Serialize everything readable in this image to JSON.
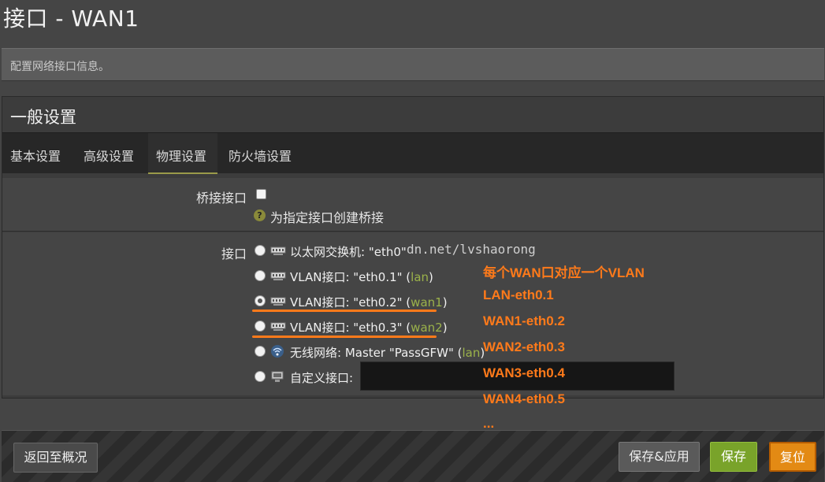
{
  "page": {
    "title": "接口 - WAN1",
    "description": "配置网络接口信息。"
  },
  "section": {
    "title": "一般设置"
  },
  "tabs": [
    {
      "label": "基本设置"
    },
    {
      "label": "高级设置"
    },
    {
      "label": "物理设置"
    },
    {
      "label": "防火墙设置"
    }
  ],
  "bridge": {
    "label": "桥接接口",
    "help": "为指定接口创建桥接",
    "checked": false
  },
  "iface": {
    "label": "接口",
    "options": [
      {
        "text": "以太网交换机: \"eth0\"",
        "net": "",
        "icon": "ethernet-switch-icon",
        "checked": false
      },
      {
        "text": "VLAN接口: \"eth0.1\" (",
        "net": "lan",
        "close": ")",
        "icon": "vlan-icon",
        "checked": false
      },
      {
        "text": "VLAN接口: \"eth0.2\" (",
        "net": "wan1",
        "close": ")",
        "icon": "vlan-icon",
        "checked": true
      },
      {
        "text": "VLAN接口: \"eth0.3\" (",
        "net": "wan2",
        "close": ")",
        "icon": "vlan-icon",
        "checked": false
      },
      {
        "text": "无线网络: Master \"PassGFW\" (",
        "net": "lan",
        "close": ")",
        "icon": "wireless-icon",
        "checked": false
      },
      {
        "text": "自定义接口:",
        "net": "",
        "icon": "custom-interface-icon",
        "checked": false
      }
    ],
    "custom_value": ""
  },
  "watermark": "dn.net/lvshaorong",
  "annotations": [
    "每个WAN口对应一个VLAN",
    "LAN-eth0.1",
    "WAN1-eth0.2",
    "WAN2-eth0.3",
    "WAN3-eth0.4",
    "WAN4-eth0.5",
    "..."
  ],
  "footer": {
    "back": "返回至概况",
    "save_apply": "保存&应用",
    "save": "保存",
    "reset": "复位"
  },
  "colors": {
    "accent": "#ff7a1a",
    "net_label": "#9bb24a",
    "save": "#79a32a",
    "reset": "#e38a14"
  }
}
